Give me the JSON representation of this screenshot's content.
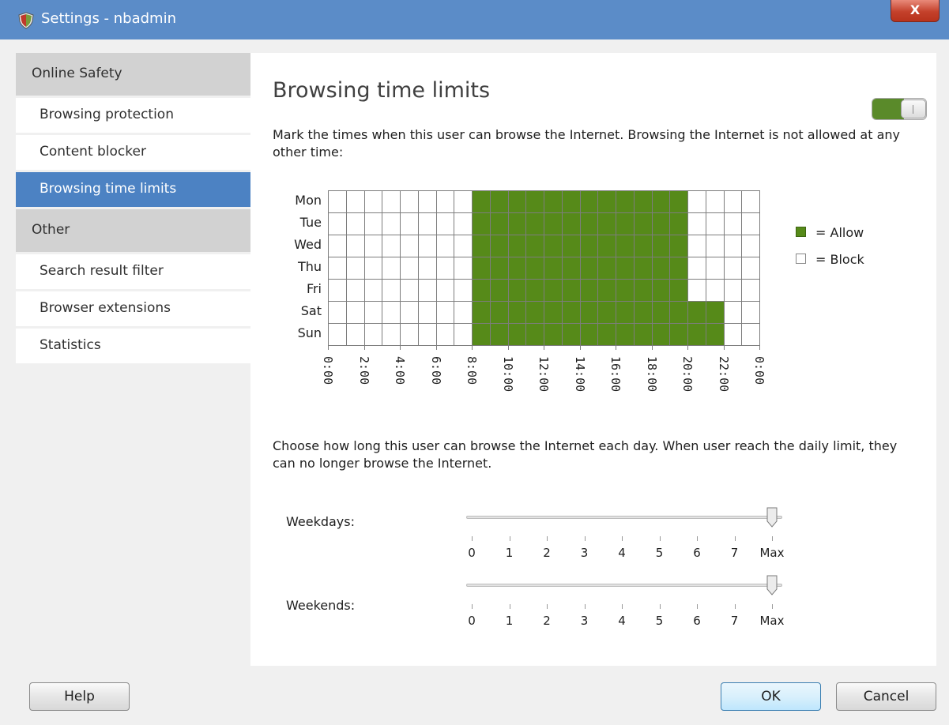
{
  "window": {
    "title": "Settings - nbadmin",
    "close_label": "X"
  },
  "sidebar": {
    "groups": [
      {
        "label": "Online Safety",
        "items": [
          "Browsing protection",
          "Content blocker",
          "Browsing time limits"
        ]
      },
      {
        "label": "Other",
        "items": [
          "Search result filter",
          "Browser extensions",
          "Statistics"
        ]
      }
    ],
    "active_item": "Browsing time limits"
  },
  "main": {
    "heading": "Browsing time limits",
    "toggle_on": true,
    "schedule_description": "Mark the times when this user can browse the Internet. Browsing the Internet is not allowed at any other time:",
    "daily_limit_description": "Choose how long this user can browse the Internet each day. When user reach the daily limit, they can no longer browse the Internet."
  },
  "schedule": {
    "days": [
      "Mon",
      "Tue",
      "Wed",
      "Thu",
      "Fri",
      "Sat",
      "Sun"
    ],
    "time_labels": [
      "0:00",
      "2:00",
      "4:00",
      "6:00",
      "8:00",
      "10:00",
      "12:00",
      "14:00",
      "16:00",
      "18:00",
      "20:00",
      "22:00",
      "0:00"
    ],
    "allowed_hours": {
      "Mon": [
        8,
        20
      ],
      "Tue": [
        8,
        20
      ],
      "Wed": [
        8,
        20
      ],
      "Thu": [
        8,
        20
      ],
      "Fri": [
        8,
        20
      ],
      "Sat": [
        8,
        22
      ],
      "Sun": [
        8,
        22
      ]
    },
    "allow_color": "#568a19",
    "block_color": "#ffffff"
  },
  "legend": {
    "allow_label": "= Allow",
    "block_label": "= Block"
  },
  "sliders": {
    "tick_labels": [
      "0",
      "1",
      "2",
      "3",
      "4",
      "5",
      "6",
      "7",
      "Max"
    ],
    "weekdays": {
      "label": "Weekdays:",
      "value": "Max"
    },
    "weekends": {
      "label": "Weekends:",
      "value": "Max"
    }
  },
  "buttons": {
    "help": "Help",
    "ok": "OK",
    "cancel": "Cancel"
  }
}
